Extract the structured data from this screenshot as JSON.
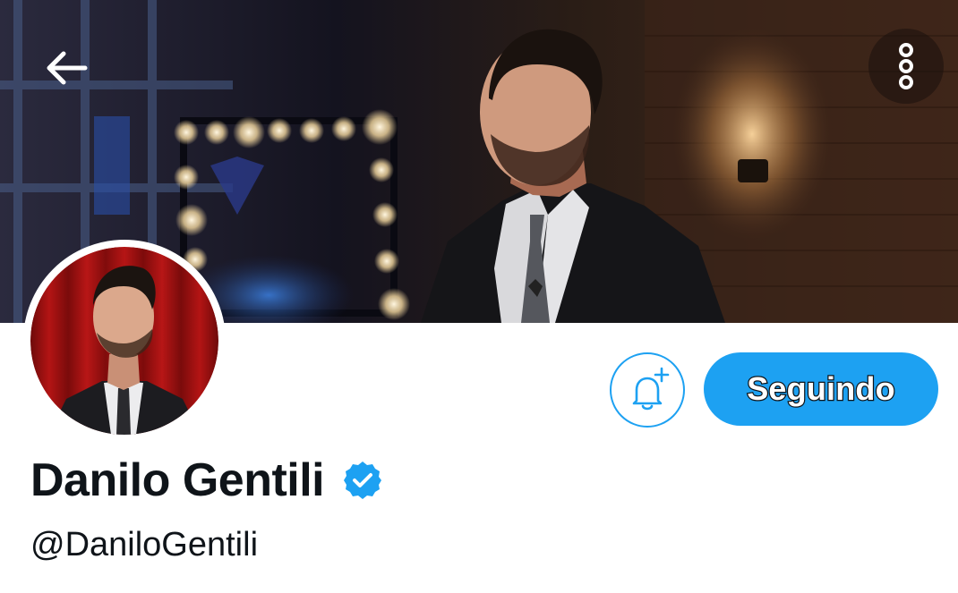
{
  "profile": {
    "display_name": "Danilo Gentili",
    "handle": "@DaniloGentili",
    "verified": true
  },
  "actions": {
    "follow_label": "Seguindo"
  },
  "icons": {
    "back": "arrow-left-icon",
    "more": "more-vertical-icon",
    "notifications": "bell-plus-icon",
    "verified": "verified-badge-icon"
  },
  "colors": {
    "accent": "#1da1f2",
    "text_primary": "#0f1419",
    "background": "#ffffff"
  }
}
